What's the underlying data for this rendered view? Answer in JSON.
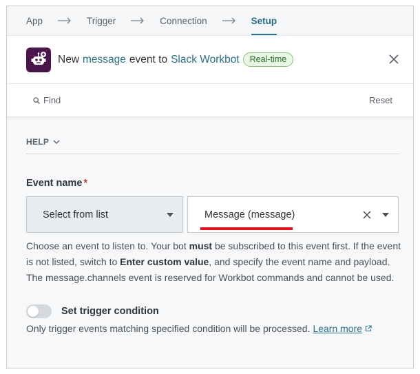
{
  "stepper": {
    "steps": [
      "App",
      "Trigger",
      "Connection",
      "Setup"
    ],
    "active": "Setup"
  },
  "header": {
    "title_prefix": "New",
    "title_event": "message",
    "title_middle": "event to",
    "title_app": "Slack Workbot",
    "badge": "Real-time",
    "app_icon": "slack-workbot-robot-icon",
    "close_icon": "close-icon"
  },
  "findbar": {
    "find_label": "Find",
    "reset_label": "Reset",
    "search_icon": "search-icon"
  },
  "help": {
    "label": "HELP"
  },
  "event_field": {
    "label": "Event name",
    "required_mark": "*",
    "mode_value": "Select from list",
    "selected_value": "Message (message)",
    "help_1": "Choose an event to listen to. Your bot ",
    "help_bold_1": "must",
    "help_2": " be subscribed to this event first. If the event is not listed, switch to ",
    "help_bold_2": "Enter custom value",
    "help_3": ", and specify the event name and payload. The message.channels event is reserved for Workbot commands and cannot be used."
  },
  "trigger_condition": {
    "label": "Set trigger condition",
    "enabled": false,
    "description": "Only trigger events matching specified condition will be processed.",
    "learn_more": "Learn more"
  },
  "colors": {
    "accent": "#2b6f88",
    "slack_purple": "#4a154b",
    "badge_green": "#8ac27d",
    "annotation_red": "#e0141e",
    "required_red": "#c0392b"
  }
}
